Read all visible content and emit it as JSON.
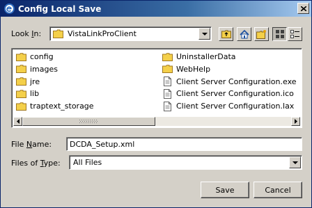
{
  "window": {
    "title": "Config Local Save"
  },
  "look_in": {
    "label_pre": "Look ",
    "label_u": "I",
    "label_post": "n:",
    "value": "VistaLinkProClient"
  },
  "files": [
    {
      "name": "config",
      "type": "folder"
    },
    {
      "name": "images",
      "type": "folder"
    },
    {
      "name": "jre",
      "type": "folder"
    },
    {
      "name": "lib",
      "type": "folder"
    },
    {
      "name": "traptext_storage",
      "type": "folder"
    },
    {
      "name": "UninstallerData",
      "type": "folder"
    },
    {
      "name": "WebHelp",
      "type": "folder"
    },
    {
      "name": "Client Server Configuration.exe",
      "type": "file"
    },
    {
      "name": "Client Server Configuration.ico",
      "type": "file"
    },
    {
      "name": "Client Server Configuration.lax",
      "type": "file"
    }
  ],
  "file_name": {
    "label_pre": "File ",
    "label_u": "N",
    "label_post": "ame:",
    "value": "DCDA_Setup.xml"
  },
  "file_type": {
    "label_pre": "Files of ",
    "label_u": "T",
    "label_post": "ype:",
    "value": "All Files"
  },
  "buttons": {
    "save": "Save",
    "cancel": "Cancel"
  },
  "colors": {
    "folder": "#f4d04a",
    "title_start": "#0a246a",
    "title_end": "#a6caf0"
  }
}
